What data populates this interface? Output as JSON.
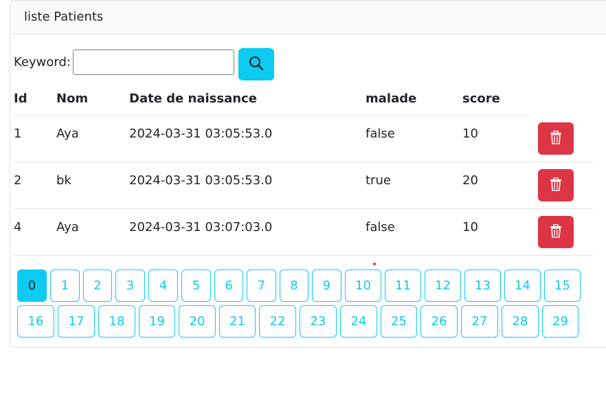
{
  "card": {
    "title": "liste Patients"
  },
  "search": {
    "label": "Keyword:",
    "value": "",
    "placeholder": "",
    "icon": "search-icon"
  },
  "table": {
    "headers": [
      "Id",
      "Nom",
      "Date de naissance",
      "malade",
      "score"
    ],
    "rows": [
      {
        "id": "1",
        "nom": "Aya",
        "date": "2024-03-31 03:05:53.0",
        "malade": "false",
        "score": "10"
      },
      {
        "id": "2",
        "nom": "bk",
        "date": "2024-03-31 03:05:53.0",
        "malade": "true",
        "score": "20"
      },
      {
        "id": "4",
        "nom": "Aya",
        "date": "2024-03-31 03:07:03.0",
        "malade": "false",
        "score": "10"
      }
    ],
    "delete_icon": "trash-icon"
  },
  "pagination": {
    "current": "0",
    "pages": [
      "0",
      "1",
      "2",
      "3",
      "4",
      "5",
      "6",
      "7",
      "8",
      "9",
      "10",
      "11",
      "12",
      "13",
      "14",
      "15",
      "16",
      "17",
      "18",
      "19",
      "20",
      "21",
      "22",
      "23",
      "24",
      "25",
      "26",
      "27",
      "28",
      "29"
    ]
  },
  "colors": {
    "info": "#0dcaf0",
    "danger": "#dc3545",
    "border": "#dee2e6",
    "header_bg": "#f8f9fa"
  }
}
